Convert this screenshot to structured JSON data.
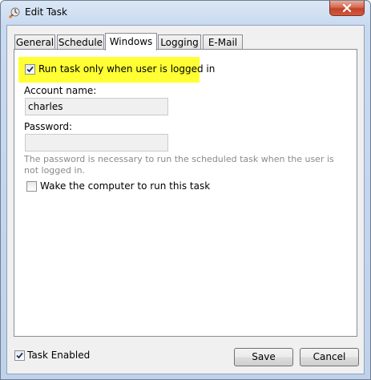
{
  "window": {
    "title": "Edit Task",
    "close_icon": "close-icon",
    "app_icon": "task-icon"
  },
  "tabs": [
    {
      "label": "General",
      "active": false
    },
    {
      "label": "Schedule",
      "active": false
    },
    {
      "label": "Windows",
      "active": true
    },
    {
      "label": "Logging",
      "active": false
    },
    {
      "label": "E-Mail",
      "active": false
    }
  ],
  "windows_tab": {
    "run_only_logged_in": {
      "label": "Run task only when user is logged in",
      "checked": true
    },
    "account_name_label": "Account name:",
    "account_name_value": "charles",
    "password_label": "Password:",
    "password_value": "",
    "password_hint": "The password is necessary to run the scheduled task when the user is not logged in.",
    "wake_computer": {
      "label": "Wake the computer to run this task",
      "checked": false
    }
  },
  "footer": {
    "task_enabled": {
      "label": "Task Enabled",
      "checked": true
    },
    "save_label": "Save",
    "cancel_label": "Cancel"
  },
  "colors": {
    "highlight": "#ffff33",
    "titlebar": "#c9daf0",
    "close_button": "#c2432b"
  }
}
